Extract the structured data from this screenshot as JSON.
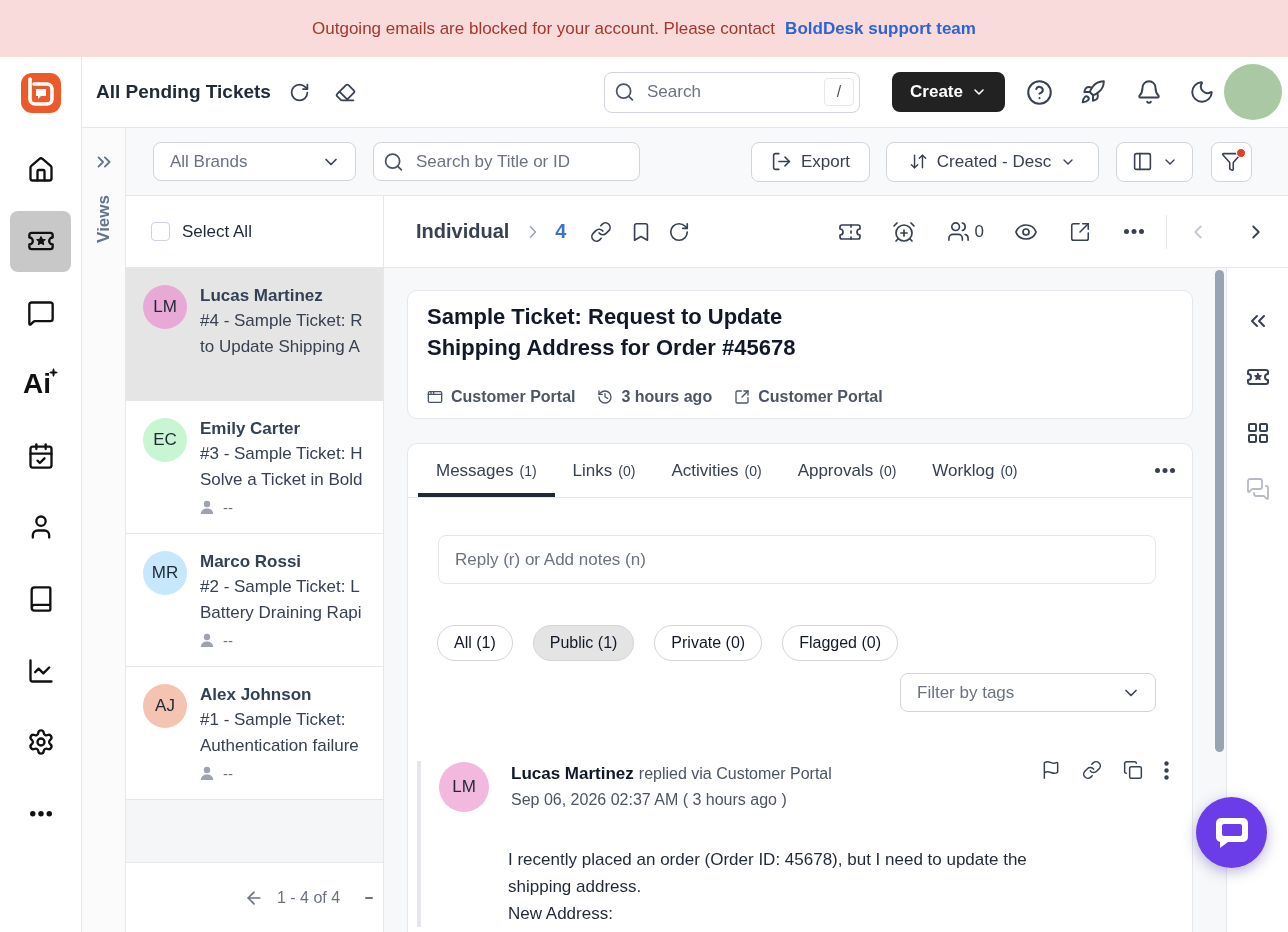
{
  "banner": {
    "message": "Outgoing emails are blocked for your account. Please contact",
    "link": "BoldDesk support team"
  },
  "nav_items": [
    {
      "selected": false
    },
    {
      "selected": true
    },
    {
      "selected": false
    },
    {
      "label": "Ai",
      "selected": false
    },
    {
      "selected": false
    },
    {
      "selected": false
    },
    {
      "selected": false
    },
    {
      "selected": false
    },
    {
      "selected": false
    },
    {
      "selected": false
    }
  ],
  "header": {
    "title": "All Pending Tickets",
    "search": {
      "placeholder": "Search",
      "shortcut": "/"
    },
    "create_button": "Create"
  },
  "views_panel": {
    "label": "Views"
  },
  "toolbar": {
    "brand_select": "All Brands",
    "search": {
      "placeholder": "Search by Title or ID"
    },
    "export_button": "Export",
    "sort_button": "Created - Desc",
    "filter_active": true
  },
  "ticket_list": {
    "select_all": {
      "label": "Select All",
      "checked": false
    },
    "tickets": [
      {
        "initials": "LM",
        "color": "#e8a9d7",
        "name": "Lucas Martinez",
        "subject_lines": [
          "#4 - Sample Ticket: R",
          "to Update Shipping A"
        ],
        "selected": true
      },
      {
        "initials": "EC",
        "color": "#c8f5d2",
        "name": "Emily Carter",
        "subject_lines": [
          "#3 - Sample Ticket: H",
          "Solve a Ticket in Bold"
        ],
        "assignee": "--",
        "selected": false
      },
      {
        "initials": "MR",
        "color": "#c7e7fb",
        "name": "Marco Rossi",
        "subject_lines": [
          "#2 - Sample Ticket: L",
          "Battery Draining Rapi"
        ],
        "assignee": "--",
        "selected": false
      },
      {
        "initials": "AJ",
        "color": "#f4c3b1",
        "name": "Alex Johnson",
        "subject_lines": [
          "#1 - Sample Ticket:",
          "Authentication failure"
        ],
        "assignee": "--",
        "selected": false
      }
    ],
    "pagination": "1 - 4 of 4"
  },
  "ticket": {
    "breadcrumb": "Individual",
    "number": "4",
    "watchers": "0",
    "previous_disabled": true,
    "next_disabled": false,
    "title": "Sample Ticket: Request to Update Shipping Address for Order #45678",
    "meta": [
      {
        "kind": "channel",
        "text": "Customer Portal"
      },
      {
        "kind": "time",
        "text": "3 hours ago"
      },
      {
        "kind": "link",
        "text": "Customer Portal"
      }
    ],
    "tabs": [
      {
        "label": "Messages",
        "count": "(1)",
        "selected": true
      },
      {
        "label": "Links",
        "count": "(0)",
        "selected": false
      },
      {
        "label": "Activities",
        "count": "(0)",
        "selected": false
      },
      {
        "label": "Approvals",
        "count": "(0)",
        "selected": false
      },
      {
        "label": "Worklog",
        "count": "(0)",
        "selected": false
      }
    ],
    "reply": {
      "placeholder": "Reply (r) or Add notes (n)"
    },
    "message_filters": [
      {
        "label": "All (1)",
        "selected": false
      },
      {
        "label": "Public (1)",
        "selected": true
      },
      {
        "label": "Private (0)",
        "selected": false
      },
      {
        "label": "Flagged (0)",
        "selected": false
      }
    ],
    "tag_filter": {
      "placeholder": "Filter by tags"
    },
    "messages": [
      {
        "initials": "LM",
        "color": "#f2b8de",
        "author": "Lucas Martinez",
        "action": "replied via Customer Portal",
        "date": "Sep 06, 2026 02:37 AM ( 3 hours ago )",
        "paragraphs": [
          "I recently placed an order (Order ID: 45678), but I need to update the shipping address.",
          "New Address:"
        ]
      }
    ]
  }
}
